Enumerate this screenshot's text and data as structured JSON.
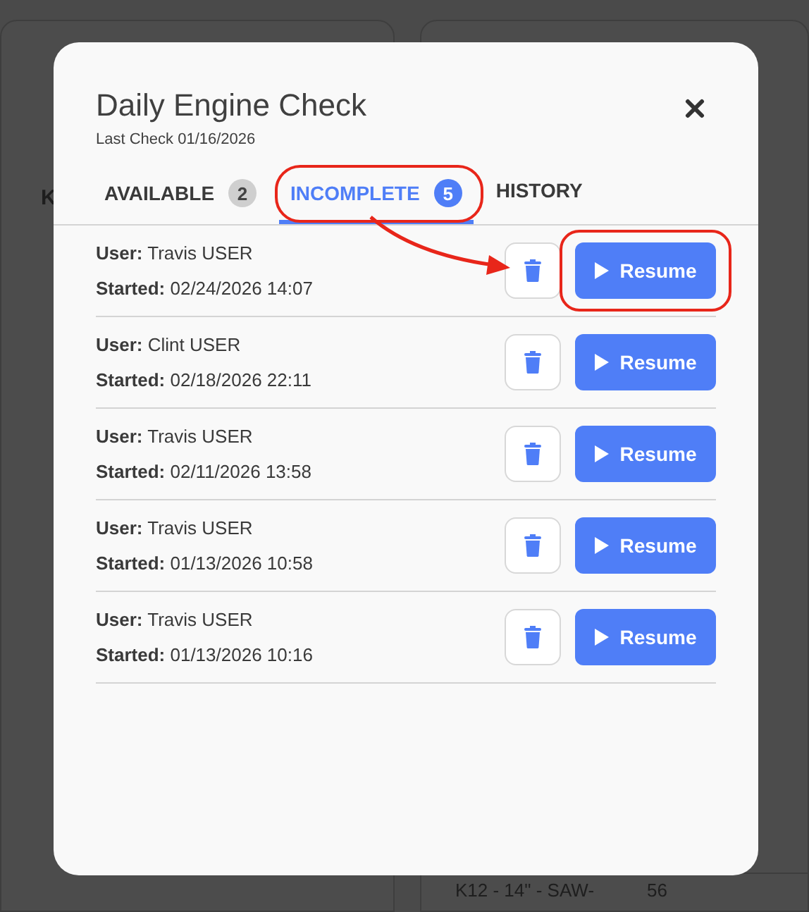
{
  "background": {
    "left_heading": "K",
    "table_row": [
      "K12 - 14\" - SAW-",
      "56"
    ]
  },
  "dialog": {
    "title": "Daily Engine Check",
    "subtitle": "Last Check 01/16/2026"
  },
  "tabs": [
    {
      "label": "AVAILABLE",
      "count": "2",
      "selected": false,
      "highlighted": false
    },
    {
      "label": "INCOMPLETE",
      "count": "5",
      "selected": true,
      "highlighted": true
    },
    {
      "label": "HISTORY",
      "selected": false,
      "highlighted": false
    }
  ],
  "entries": [
    {
      "user": "**User:** Travis USER",
      "started": "**Started:** 02/24/2026 14:07",
      "action": "Resume",
      "highlighted": true
    },
    {
      "user": "**User:** Clint USER",
      "started": "**Started:** 02/18/2026 22:11",
      "action": "Resume",
      "highlighted": false
    },
    {
      "user": "**User:** Travis USER",
      "started": "**Started:** 02/11/2026 13:58",
      "action": "Resume",
      "highlighted": false
    },
    {
      "user": "**User:** Travis USER",
      "started": "**Started:** 01/13/2026 10:58",
      "action": "Resume",
      "highlighted": false
    },
    {
      "user": "**User:** Travis USER",
      "started": "**Started:** 01/13/2026 10:16",
      "action": "Resume",
      "highlighted": false
    }
  ]
}
